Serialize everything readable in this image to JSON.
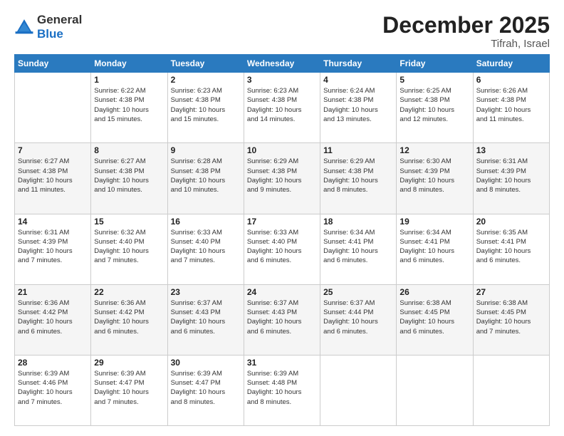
{
  "logo": {
    "line1": "General",
    "line2": "Blue"
  },
  "header": {
    "title": "December 2025",
    "subtitle": "Tifrah, Israel"
  },
  "days_of_week": [
    "Sunday",
    "Monday",
    "Tuesday",
    "Wednesday",
    "Thursday",
    "Friday",
    "Saturday"
  ],
  "weeks": [
    [
      {
        "day": "",
        "info": ""
      },
      {
        "day": "1",
        "info": "Sunrise: 6:22 AM\nSunset: 4:38 PM\nDaylight: 10 hours\nand 15 minutes."
      },
      {
        "day": "2",
        "info": "Sunrise: 6:23 AM\nSunset: 4:38 PM\nDaylight: 10 hours\nand 15 minutes."
      },
      {
        "day": "3",
        "info": "Sunrise: 6:23 AM\nSunset: 4:38 PM\nDaylight: 10 hours\nand 14 minutes."
      },
      {
        "day": "4",
        "info": "Sunrise: 6:24 AM\nSunset: 4:38 PM\nDaylight: 10 hours\nand 13 minutes."
      },
      {
        "day": "5",
        "info": "Sunrise: 6:25 AM\nSunset: 4:38 PM\nDaylight: 10 hours\nand 12 minutes."
      },
      {
        "day": "6",
        "info": "Sunrise: 6:26 AM\nSunset: 4:38 PM\nDaylight: 10 hours\nand 11 minutes."
      }
    ],
    [
      {
        "day": "7",
        "info": "Sunrise: 6:27 AM\nSunset: 4:38 PM\nDaylight: 10 hours\nand 11 minutes."
      },
      {
        "day": "8",
        "info": "Sunrise: 6:27 AM\nSunset: 4:38 PM\nDaylight: 10 hours\nand 10 minutes."
      },
      {
        "day": "9",
        "info": "Sunrise: 6:28 AM\nSunset: 4:38 PM\nDaylight: 10 hours\nand 10 minutes."
      },
      {
        "day": "10",
        "info": "Sunrise: 6:29 AM\nSunset: 4:38 PM\nDaylight: 10 hours\nand 9 minutes."
      },
      {
        "day": "11",
        "info": "Sunrise: 6:29 AM\nSunset: 4:38 PM\nDaylight: 10 hours\nand 8 minutes."
      },
      {
        "day": "12",
        "info": "Sunrise: 6:30 AM\nSunset: 4:39 PM\nDaylight: 10 hours\nand 8 minutes."
      },
      {
        "day": "13",
        "info": "Sunrise: 6:31 AM\nSunset: 4:39 PM\nDaylight: 10 hours\nand 8 minutes."
      }
    ],
    [
      {
        "day": "14",
        "info": "Sunrise: 6:31 AM\nSunset: 4:39 PM\nDaylight: 10 hours\nand 7 minutes."
      },
      {
        "day": "15",
        "info": "Sunrise: 6:32 AM\nSunset: 4:40 PM\nDaylight: 10 hours\nand 7 minutes."
      },
      {
        "day": "16",
        "info": "Sunrise: 6:33 AM\nSunset: 4:40 PM\nDaylight: 10 hours\nand 7 minutes."
      },
      {
        "day": "17",
        "info": "Sunrise: 6:33 AM\nSunset: 4:40 PM\nDaylight: 10 hours\nand 6 minutes."
      },
      {
        "day": "18",
        "info": "Sunrise: 6:34 AM\nSunset: 4:41 PM\nDaylight: 10 hours\nand 6 minutes."
      },
      {
        "day": "19",
        "info": "Sunrise: 6:34 AM\nSunset: 4:41 PM\nDaylight: 10 hours\nand 6 minutes."
      },
      {
        "day": "20",
        "info": "Sunrise: 6:35 AM\nSunset: 4:41 PM\nDaylight: 10 hours\nand 6 minutes."
      }
    ],
    [
      {
        "day": "21",
        "info": "Sunrise: 6:36 AM\nSunset: 4:42 PM\nDaylight: 10 hours\nand 6 minutes."
      },
      {
        "day": "22",
        "info": "Sunrise: 6:36 AM\nSunset: 4:42 PM\nDaylight: 10 hours\nand 6 minutes."
      },
      {
        "day": "23",
        "info": "Sunrise: 6:37 AM\nSunset: 4:43 PM\nDaylight: 10 hours\nand 6 minutes."
      },
      {
        "day": "24",
        "info": "Sunrise: 6:37 AM\nSunset: 4:43 PM\nDaylight: 10 hours\nand 6 minutes."
      },
      {
        "day": "25",
        "info": "Sunrise: 6:37 AM\nSunset: 4:44 PM\nDaylight: 10 hours\nand 6 minutes."
      },
      {
        "day": "26",
        "info": "Sunrise: 6:38 AM\nSunset: 4:45 PM\nDaylight: 10 hours\nand 6 minutes."
      },
      {
        "day": "27",
        "info": "Sunrise: 6:38 AM\nSunset: 4:45 PM\nDaylight: 10 hours\nand 7 minutes."
      }
    ],
    [
      {
        "day": "28",
        "info": "Sunrise: 6:39 AM\nSunset: 4:46 PM\nDaylight: 10 hours\nand 7 minutes."
      },
      {
        "day": "29",
        "info": "Sunrise: 6:39 AM\nSunset: 4:47 PM\nDaylight: 10 hours\nand 7 minutes."
      },
      {
        "day": "30",
        "info": "Sunrise: 6:39 AM\nSunset: 4:47 PM\nDaylight: 10 hours\nand 8 minutes."
      },
      {
        "day": "31",
        "info": "Sunrise: 6:39 AM\nSunset: 4:48 PM\nDaylight: 10 hours\nand 8 minutes."
      },
      {
        "day": "",
        "info": ""
      },
      {
        "day": "",
        "info": ""
      },
      {
        "day": "",
        "info": ""
      }
    ]
  ]
}
